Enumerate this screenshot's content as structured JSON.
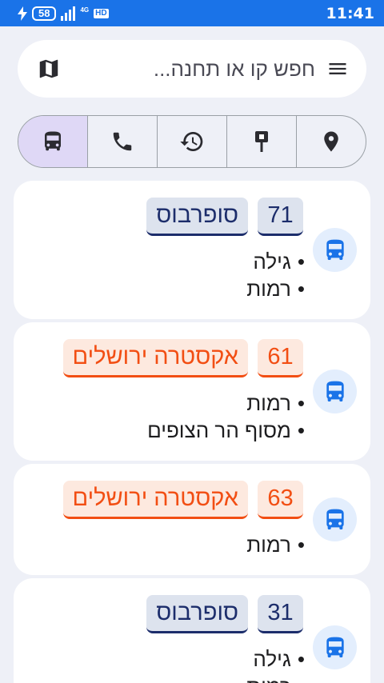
{
  "status_bar": {
    "battery": "58",
    "network": "4G",
    "hd": "HD",
    "time": "11:41"
  },
  "search": {
    "placeholder": "חפש קו או תחנה..."
  },
  "icons": {
    "menu": "menu-icon",
    "map": "map-icon",
    "bus": "bus-icon",
    "phone": "phone-icon",
    "history": "history-icon",
    "stop": "bus-stop-icon",
    "location": "location-pin-icon"
  },
  "tabs": [
    {
      "name": "bus",
      "selected": true
    },
    {
      "name": "phone",
      "selected": false
    },
    {
      "name": "history",
      "selected": false
    },
    {
      "name": "stop",
      "selected": false
    },
    {
      "name": "location",
      "selected": false
    }
  ],
  "colors": {
    "accent": "#1a73e8",
    "navy": "#1c2d6b",
    "orange": "#f24e13",
    "selected_tab": "#dfd8f6"
  },
  "lines": [
    {
      "number": "71",
      "operator": "סופרבוס",
      "destinations": [
        "גילה",
        "רמות"
      ]
    },
    {
      "number": "61",
      "operator": "אקסטרה ירושלים",
      "destinations": [
        "רמות",
        "מסוף הר הצופים"
      ]
    },
    {
      "number": "63",
      "operator": "אקסטרה ירושלים",
      "destinations": [
        "רמות"
      ]
    },
    {
      "number": "31",
      "operator": "סופרבוס",
      "destinations": [
        "גילה",
        "רמות"
      ]
    }
  ]
}
